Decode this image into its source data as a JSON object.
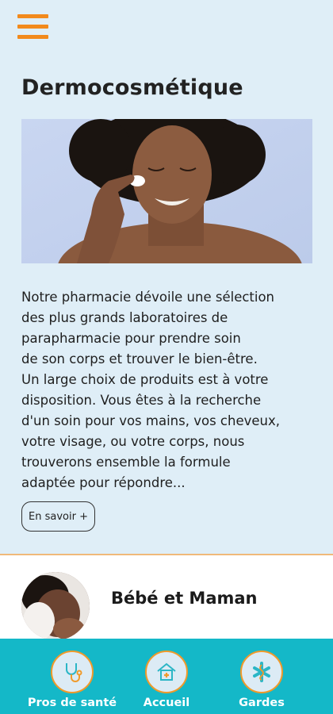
{
  "header": {
    "menu_icon": "hamburger-menu-icon",
    "accent_color": "#f28a1c"
  },
  "section": {
    "title": "Dermocosmétique",
    "description": "Notre pharmacie dévoile une sélection\ndes plus grands laboratoires de\nparapharmacie pour prendre soin\nde son corps et trouver le bien-être.\nUn large choix de produits est à votre\ndisposition. Vous êtes à la recherche\nd'un soin pour vos mains, vos cheveux,\nvotre visage, ou votre corps, nous\ntrouverons ensemble la formule\nadaptée pour répondre...",
    "button_label": "En savoir +"
  },
  "category": {
    "title": "Bébé et Maman"
  },
  "bottom_nav": {
    "background": "#14b8c8",
    "items": [
      {
        "label": "Pros de santé",
        "icon": "stethoscope-icon"
      },
      {
        "label": "Accueil",
        "icon": "home-medical-icon"
      },
      {
        "label": "Gardes",
        "icon": "medical-caduceus-icon"
      }
    ]
  }
}
